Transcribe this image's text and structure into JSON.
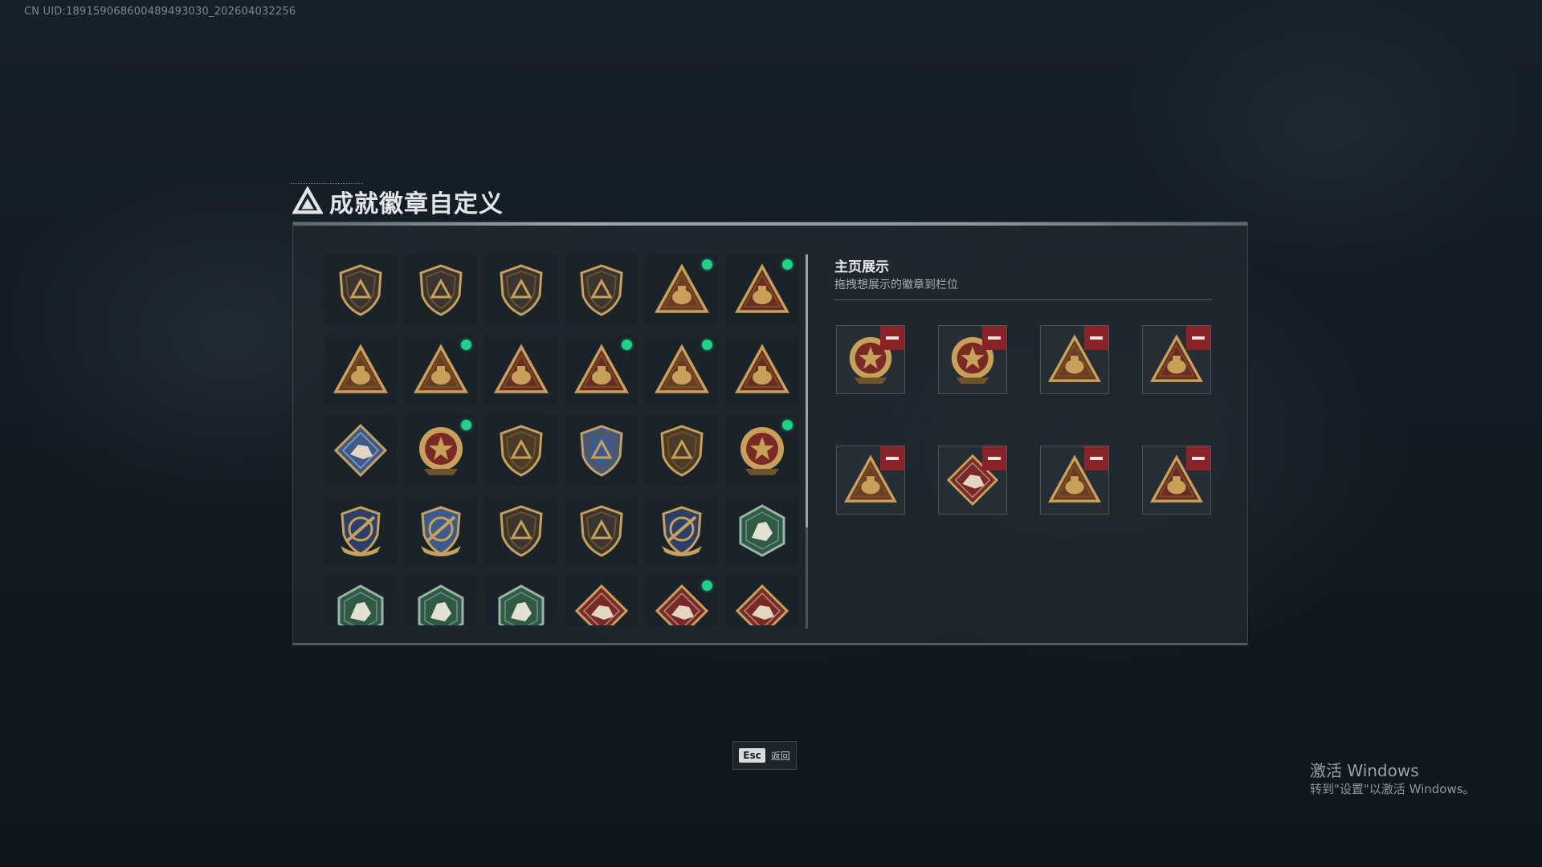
{
  "uid_text": "CN UID:18915906860048949303​0_202604032256",
  "title": "成就徽章自定义",
  "colors": {
    "gold": "#c7a15a",
    "gold_dark": "#6e5228",
    "red": "#8b2228",
    "green_dot": "#1fd28a",
    "blue_badge": "#3d5a8c",
    "green_badge": "#2f5a45"
  },
  "badges": [
    {
      "icon": "shield-triangle-badge-icon",
      "shape": "shield",
      "color": "#3a3530",
      "dot": false
    },
    {
      "icon": "shield-helicopter-badge-icon",
      "shape": "shield",
      "color": "#3a3530",
      "dot": false
    },
    {
      "icon": "shield-diamond-badge-icon",
      "shape": "shield",
      "color": "#3a3530",
      "dot": false
    },
    {
      "icon": "shield-dagger-badge-icon",
      "shape": "shield",
      "color": "#3a3530",
      "dot": false
    },
    {
      "icon": "triangle-gear-badge-icon",
      "shape": "triangle",
      "color": "#6e3a22",
      "dot": true
    },
    {
      "icon": "triangle-trophy-badge-icon",
      "shape": "triangle",
      "color": "#6e2a22",
      "dot": true
    },
    {
      "icon": "triangle-helmet-badge-icon",
      "shape": "triangle",
      "color": "#6e3a22",
      "dot": false
    },
    {
      "icon": "triangle-tank-badge-icon",
      "shape": "triangle",
      "color": "#6e3a22",
      "dot": true
    },
    {
      "icon": "triangle-number-one-badge-icon",
      "shape": "triangle",
      "color": "#6e2a22",
      "dot": false
    },
    {
      "icon": "triangle-bottle-badge-icon",
      "shape": "triangle",
      "color": "#6e2a22",
      "dot": true
    },
    {
      "icon": "triangle-hands-badge-icon",
      "shape": "triangle",
      "color": "#6e3a22",
      "dot": true
    },
    {
      "icon": "triangle-soldiers-badge-icon",
      "shape": "triangle",
      "color": "#6e2a22",
      "dot": false
    },
    {
      "icon": "diamond-rifle-badge-icon",
      "shape": "diamond",
      "color": "#3d5a8c",
      "dot": false
    },
    {
      "icon": "round-star-badge-icon",
      "shape": "round",
      "color": "#7a2a26",
      "dot": true
    },
    {
      "icon": "shield-emblem-badge-icon",
      "shape": "shield",
      "color": "#4a3b28",
      "dot": false
    },
    {
      "icon": "blue-police-badge-icon",
      "shape": "shield",
      "color": "#3d5a8c",
      "dot": false
    },
    {
      "icon": "shield-lion-badge-icon",
      "shape": "shield",
      "color": "#4a3b28",
      "dot": false
    },
    {
      "icon": "round-flower-badge-icon",
      "shape": "round",
      "color": "#7a2a26",
      "dot": true
    },
    {
      "icon": "gold-crossed-rifles-badge-icon",
      "shape": "crest",
      "color": "#2c3e6a",
      "dot": false
    },
    {
      "icon": "blue-crossed-rifles-badge-icon",
      "shape": "crest",
      "color": "#3d5a8c",
      "dot": false
    },
    {
      "icon": "shield-no-entry-badge-icon",
      "shape": "shield",
      "color": "#3a3530",
      "dot": false
    },
    {
      "icon": "shield-crossed-gun-badge-icon",
      "shape": "shield",
      "color": "#3a3530",
      "dot": false
    },
    {
      "icon": "gold-crossed-gun-badge-icon",
      "shape": "crest",
      "color": "#2c3e6a",
      "dot": false
    },
    {
      "icon": "green-eagle-badge-icon",
      "shape": "hex",
      "color": "#2f5a45",
      "dot": false
    },
    {
      "icon": "green-bee-badge-icon",
      "shape": "hex",
      "color": "#2f5a45",
      "dot": false
    },
    {
      "icon": "green-wing-badge-icon",
      "shape": "hex",
      "color": "#2f5a45",
      "dot": false
    },
    {
      "icon": "green-soldier-badge-icon",
      "shape": "hex",
      "color": "#2f5a45",
      "dot": false
    },
    {
      "icon": "red-dragon-badge-icon",
      "shape": "diamond",
      "color": "#7a2a26",
      "dot": false
    },
    {
      "icon": "red-dragon-2-badge-icon",
      "shape": "diamond",
      "color": "#7a2a26",
      "dot": true
    },
    {
      "icon": "red-runner-badge-icon",
      "shape": "diamond",
      "color": "#7a2a26",
      "dot": false
    }
  ],
  "showcase": {
    "title": "主页展示",
    "subtitle": "拖拽想展示的徽章到栏位",
    "slots": [
      {
        "icon": "round-flower-badge-icon",
        "shape": "round",
        "color": "#7a2a26"
      },
      {
        "icon": "round-star-badge-icon",
        "shape": "round",
        "color": "#7a2a26"
      },
      {
        "icon": "triangle-hands-badge-icon",
        "shape": "triangle",
        "color": "#6e3a22"
      },
      {
        "icon": "triangle-bottle-badge-icon",
        "shape": "triangle",
        "color": "#6e2a22"
      },
      {
        "icon": "triangle-tank-badge-icon",
        "shape": "triangle",
        "color": "#6e3a22"
      },
      {
        "icon": "red-dragon-2-badge-icon",
        "shape": "diamond",
        "color": "#7a2a26"
      },
      {
        "icon": "triangle-gear-badge-icon",
        "shape": "triangle",
        "color": "#6e3a22"
      },
      {
        "icon": "triangle-trophy-badge-icon",
        "shape": "triangle",
        "color": "#6e2a22"
      }
    ]
  },
  "esc": {
    "key": "Esc",
    "label": "返回"
  },
  "watermark": {
    "line1": "激活 Windows",
    "line2": "转到\"设置\"以激活 Windows。"
  }
}
